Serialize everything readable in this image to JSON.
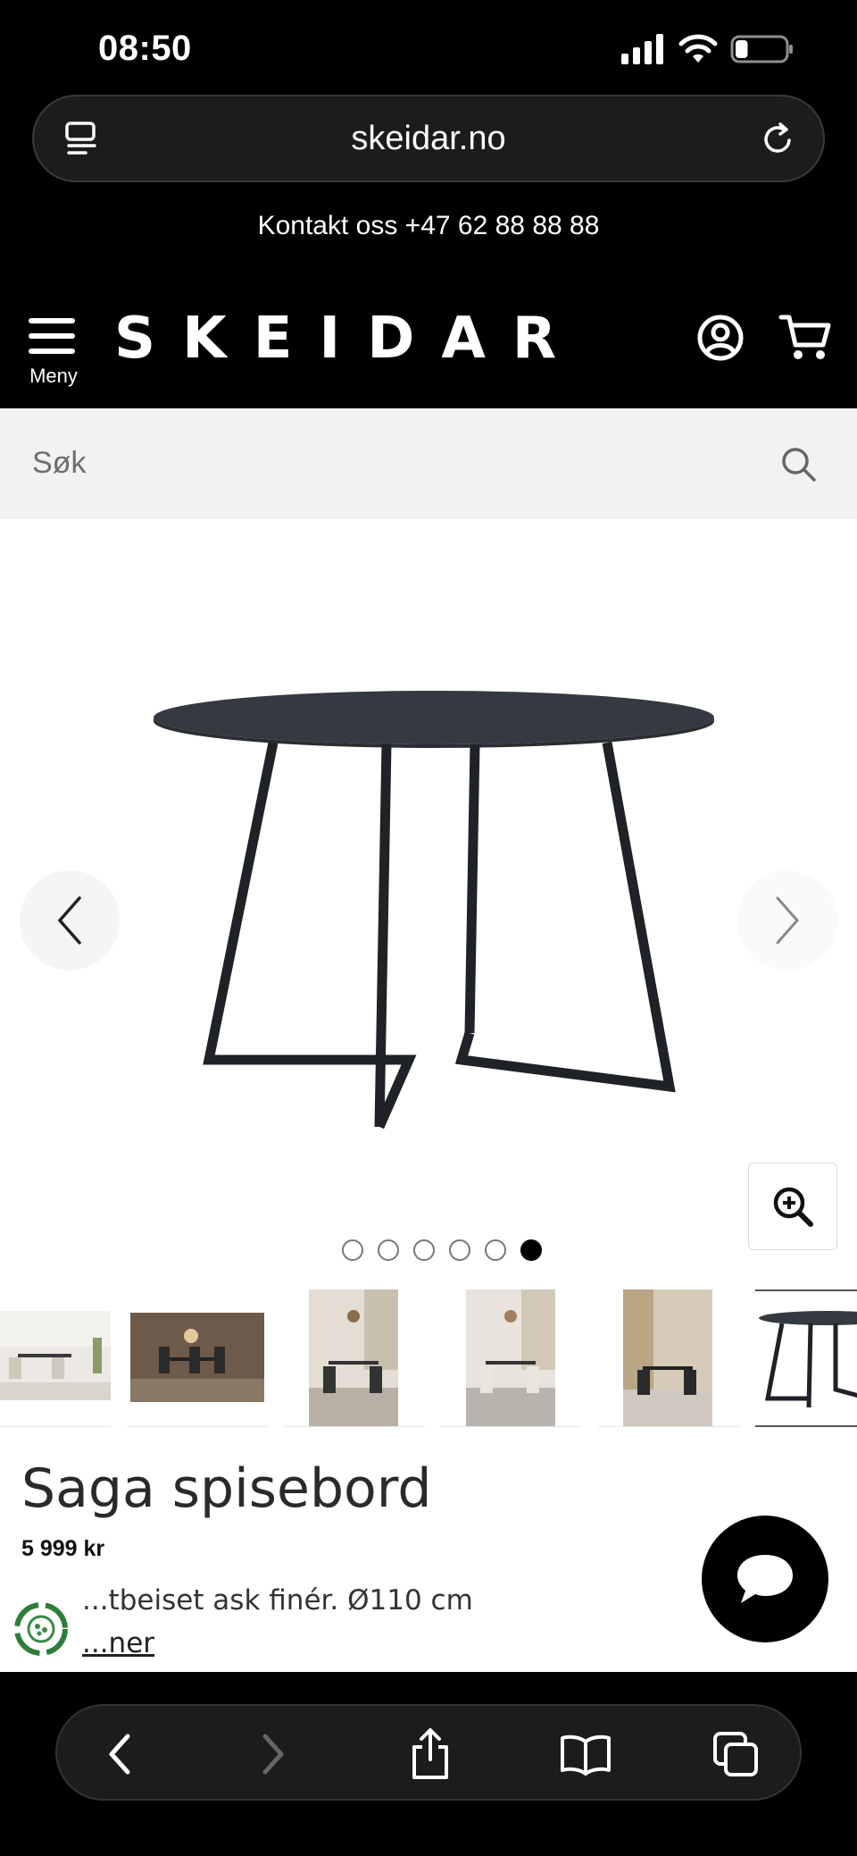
{
  "status_bar": {
    "time": "08:50",
    "battery_level": 0.25
  },
  "browser": {
    "url": "skeidar.no"
  },
  "contact": {
    "text": "Kontakt oss +47 62 88 88 88"
  },
  "header": {
    "menu_label": "Meny",
    "logo_text": "SKEIDAR",
    "icons": [
      "menu-icon",
      "account-icon",
      "cart-icon"
    ]
  },
  "search": {
    "placeholder": "Søk"
  },
  "gallery": {
    "image_count": 6,
    "active_index": 5,
    "thumbnail_count": 6
  },
  "product": {
    "title": "Saga spisebord",
    "price": "5 999 kr",
    "description": "...tbeiset ask finér. Ø110 cm",
    "more_link": "...ner"
  },
  "colors": {
    "brand": "#000000",
    "background": "#ffffff",
    "search_bg": "#f2f2f2"
  }
}
